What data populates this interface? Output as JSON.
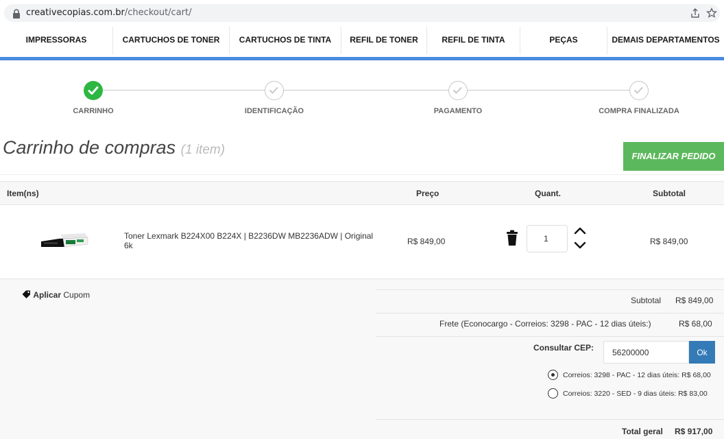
{
  "browser": {
    "url_host": "creativecopias.com.br",
    "url_path": "/checkout/cart/",
    "icons": [
      "lock-icon",
      "share-icon",
      "star-icon"
    ]
  },
  "nav": {
    "items": [
      {
        "label": "IMPRESSORAS"
      },
      {
        "label": "CARTUCHOS DE TONER"
      },
      {
        "label": "CARTUCHOS DE TINTA"
      },
      {
        "label": "REFIL DE TONER"
      },
      {
        "label": "REFIL DE TINTA"
      },
      {
        "label": "PEÇAS"
      },
      {
        "label": "DEMAIS DEPARTAMENTOS"
      }
    ]
  },
  "steps": [
    {
      "label": "CARRINHO",
      "completed": true
    },
    {
      "label": "IDENTIFICAÇÃO",
      "completed": false
    },
    {
      "label": "PAGAMENTO",
      "completed": false
    },
    {
      "label": "COMPRA FINALIZADA",
      "completed": false
    }
  ],
  "cart": {
    "title": "Carrinho de compras",
    "count": "(1 item)",
    "finalize_label": "FINALIZAR PEDIDO",
    "headers": {
      "item": "Item(ns)",
      "price": "Preço",
      "qty": "Quant.",
      "subtotal": "Subtotal"
    },
    "items": [
      {
        "name": "Toner Lexmark B224X00 B224X | B2236DW MB2236ADW | Original 6k",
        "price": "R$ 849,00",
        "quantity": "1",
        "subtotal": "R$ 849,00"
      }
    ]
  },
  "coupon": {
    "bold": "Aplicar",
    "rest": "Cupom"
  },
  "summary": {
    "subtotal_label": "Subtotal",
    "subtotal_value": "R$ 849,00",
    "frete_label": "Frete (Econocargo - Correios: 3298 - PAC - 12 dias úteis:)",
    "frete_value": "R$ 68,00",
    "cep_label": "Consultar CEP:",
    "cep_value": "56200000",
    "ok_label": "Ok",
    "shipping_options": [
      {
        "label": "Correios: 3298 - PAC - 12 dias úteis: R$ 68,00",
        "selected": true
      },
      {
        "label": "Correios: 3220 - SED - 9 dias úteis: R$ 83,00",
        "selected": false
      }
    ],
    "total_label": "Total geral",
    "total_value": "R$ 917,00"
  },
  "colors": {
    "accent_blue": "#4a8ae0",
    "success_green": "#5cb85c",
    "ok_blue": "#337ab7",
    "step_done": "#2db742"
  }
}
